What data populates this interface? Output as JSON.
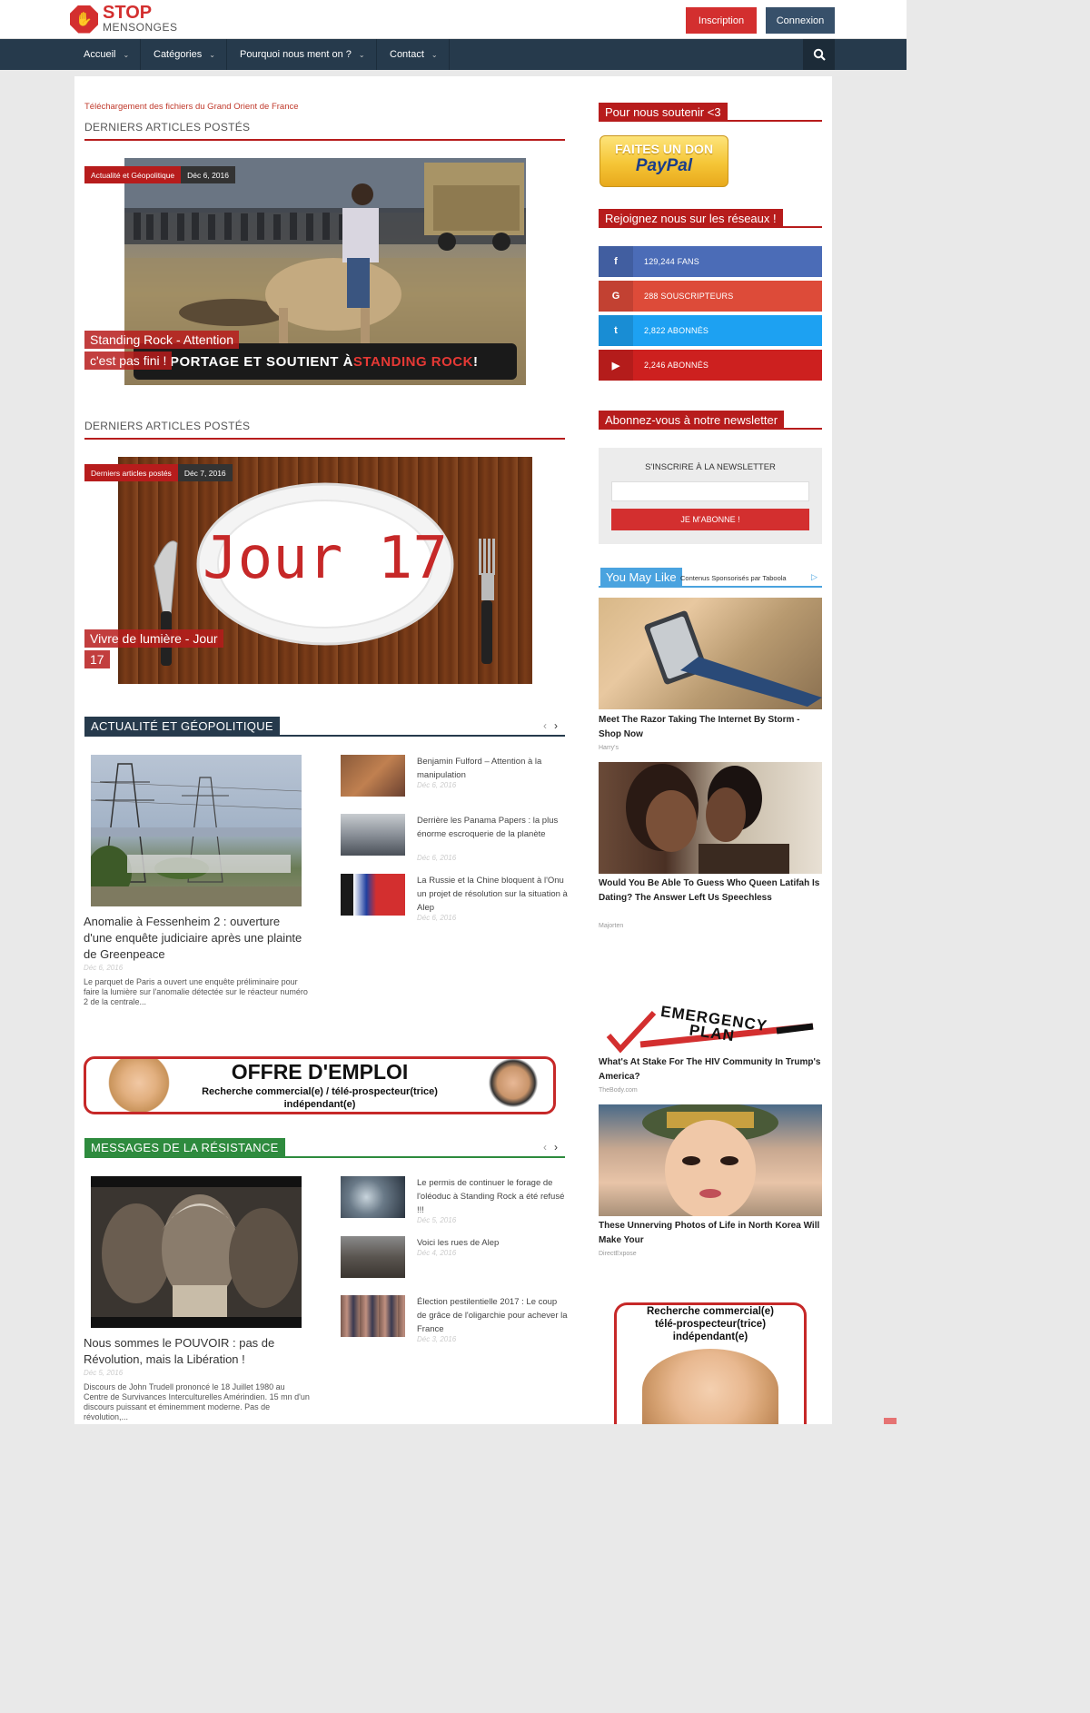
{
  "header": {
    "logo_top": "STOP",
    "logo_bottom": "MENSONGES",
    "signup": "Inscription",
    "login": "Connexion"
  },
  "nav": {
    "items": [
      "Accueil",
      "Catégories",
      "Pourquoi nous ment on ?",
      "Contact"
    ]
  },
  "breaking": "Téléchargement des fichiers du Grand Orient de France",
  "section1": {
    "title": "DERNIERS ARTICLES POSTÉS",
    "category": "Actualité et Géopolitique",
    "date": "Déc 6, 2016",
    "post_title_line1": "Standing Rock - Attention",
    "post_title_line2": "c'est pas fini !",
    "banner_text_a": "PORTAGE ET SOUTIENT À ",
    "banner_text_b": "STANDING ROCK",
    "banner_text_c": " !"
  },
  "section2": {
    "title": "DERNIERS ARTICLES POSTÉS",
    "category": "Derniers articles postés",
    "date": "Déc 7, 2016",
    "plate_text": "Jour 17",
    "post_title_line1": "Vivre de lumière - Jour",
    "post_title_line2": "17"
  },
  "cat1": {
    "title": "ACTUALITÉ ET GÉOPOLITIQUE",
    "color": "#263a4c",
    "main_title": "Anomalie à Fessenheim 2 : ouverture d'une enquête judiciaire après une plainte de Greenpeace",
    "main_date": "Déc 6, 2016",
    "main_excerpt": "Le parquet de Paris a ouvert une enquête préliminaire pour faire la lumière sur l'anomalie détectée sur le réacteur numéro 2 de la centrale...",
    "items": [
      {
        "title": "Benjamin Fulford – Attention à la manipulation",
        "date": "Déc 6, 2016"
      },
      {
        "title": "Derrière les Panama Papers : la plus énorme escroquerie de la planète",
        "date": "Déc 6, 2016"
      },
      {
        "title": "La Russie et la Chine bloquent à l'Onu un projet de résolution sur la situation à Alep",
        "date": "Déc 6, 2016"
      }
    ]
  },
  "job_ad": {
    "title": "OFFRE D'EMPLOI",
    "line1": "Recherche commercial(e) / télé-prospecteur(trice)",
    "line2": "indépendant(e)"
  },
  "cat2": {
    "title": "MESSAGES DE LA RÉSISTANCE",
    "color": "#2e8b3e",
    "main_title": "Nous sommes le POUVOIR : pas de Révolution, mais la Libération !",
    "main_date": "Déc 5, 2016",
    "main_excerpt": "Discours de John Trudell prononcé le 18 Juillet 1980 au Centre de Survivances Interculturelles Amérindien. 15 mn d'un discours puissant et éminemment moderne. Pas de révolution,...",
    "items": [
      {
        "title": "Le permis de continuer le forage de l'oléoduc à Standing Rock a été refusé !!!",
        "date": "Déc 5, 2016"
      },
      {
        "title": "Voici les rues de Alep",
        "date": "Déc 4, 2016"
      },
      {
        "title": "Élection pestilentielle 2017 : Le coup de grâce de l'oligarchie pour achever la France",
        "date": "Déc 3, 2016"
      }
    ]
  },
  "sidebar": {
    "support_title": "Pour nous soutenir <3",
    "paypal_top": "FAITES UN DON",
    "paypal_bottom": "PayPal",
    "social_title": "Rejoignez nous sur les réseaux !",
    "social": [
      {
        "icon": "f",
        "text": "129,244 FANS",
        "color": "#4b6cb7"
      },
      {
        "icon": "G",
        "text": "288 SOUSCRIPTEURS",
        "color": "#dd4b39"
      },
      {
        "icon": "t",
        "text": "2,822 ABONNÉS",
        "color": "#1da1f2"
      },
      {
        "icon": "▶",
        "text": "2,246 ABONNÉS",
        "color": "#cd201f"
      }
    ],
    "newsletter_title": "Abonnez-vous à notre newsletter",
    "newsletter_label": "S'INSCRIRE À LA NEWSLETTER",
    "newsletter_button": "JE M'ABONNE !",
    "taboola_title": "You May Like",
    "taboola_sponsor": "Contenus Sponsorisés par Taboola",
    "ads": [
      {
        "title": "Meet The Razor Taking The Internet By Storm - Shop Now",
        "source": "Harry's"
      },
      {
        "title": "Would You Be Able To Guess Who Queen Latifah Is Dating? The Answer Left Us Speechless",
        "source": "Majorten"
      },
      {
        "title": "What's At Stake For The HIV Community In Trump's America?",
        "source": "TheBody.com",
        "image_text": "EMERGENCY PLAN"
      },
      {
        "title": "These Unnerving Photos of Life in North Korea Will Make Your",
        "source": "DirectExpose"
      }
    ],
    "job_ad_line1": "Recherche commercial(e)",
    "job_ad_line2": "télé-prospecteur(trice)",
    "job_ad_line3": "indépendant(e)"
  }
}
